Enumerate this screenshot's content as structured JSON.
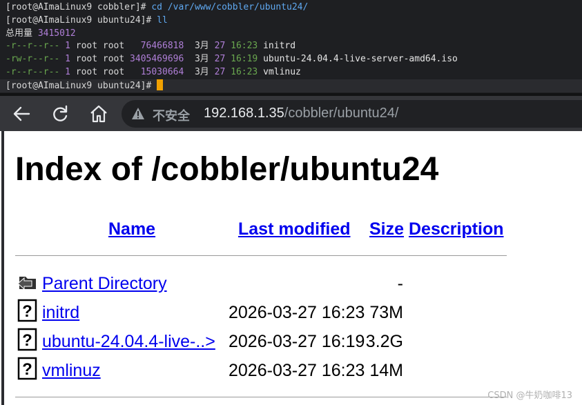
{
  "terminal": {
    "lines": [
      {
        "prompt": "[root@AImaLinux9 cobbler]# ",
        "cmd": "cd /var/www/cobbler/ubuntu24/"
      },
      {
        "prompt": "[root@AImaLinux9 ubuntu24]# ",
        "cmd": "ll"
      },
      {
        "total_label": "总用量 ",
        "total_value": "3415012"
      },
      {
        "perm": "-r--r--r--",
        "links": "1",
        "owner": "root root",
        "size": "  76466818",
        "month": "3月",
        "day": "27",
        "time": "16:23",
        "name": "initrd"
      },
      {
        "perm": "-rw-r--r--",
        "links": "1",
        "owner": "root root",
        "size": "3405469696",
        "month": "3月",
        "day": "27",
        "time": "16:19",
        "name": "ubuntu-24.04.4-live-server-amd64.iso"
      },
      {
        "perm": "-r--r--r--",
        "links": "1",
        "owner": "root root",
        "size": "  15030664",
        "month": "3月",
        "day": "27",
        "time": "16:23",
        "name": "vmlinuz"
      },
      {
        "prompt": "[root@AImaLinux9 ubuntu24]# "
      }
    ]
  },
  "browser": {
    "insecure_label": "不安全",
    "url_host": "192.168.1.35",
    "url_path": "/cobbler/ubuntu24/"
  },
  "page": {
    "title": "Index of /cobbler/ubuntu24",
    "columns": {
      "name": "Name",
      "last_modified": "Last modified",
      "size": "Size",
      "description": "Description"
    },
    "rows": [
      {
        "icon": "back-folder-icon",
        "name": "Parent Directory",
        "date": "",
        "size": "-"
      },
      {
        "icon": "unknown-file-icon",
        "name": "initrd",
        "date": "2026-03-27 16:23",
        "size": "73M"
      },
      {
        "icon": "unknown-file-icon",
        "name": "ubuntu-24.04.4-live-..>",
        "date": "2026-03-27 16:19",
        "size": "3.2G"
      },
      {
        "icon": "unknown-file-icon",
        "name": "vmlinuz",
        "date": "2026-03-27 16:23",
        "size": "14M"
      }
    ]
  },
  "watermark": "CSDN @牛奶咖啡13"
}
